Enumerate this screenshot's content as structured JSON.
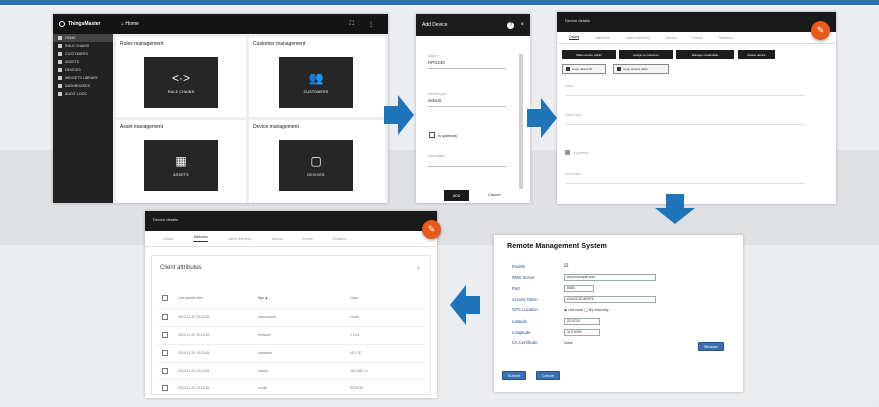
{
  "colors": {
    "accent": "#1f74ba",
    "fab": "#e85a1b",
    "dark": "#1a1a1a"
  },
  "panel1": {
    "logo": "ThingsMaster",
    "home": "Home",
    "sidebar": [
      "Home",
      "Rule chains",
      "Customers",
      "Assets",
      "Devices",
      "Widgets library",
      "Dashboards",
      "Audit logs"
    ],
    "cards": [
      {
        "title": "Rules management",
        "tile": "RULE CHAINS",
        "icon": "<·>"
      },
      {
        "title": "Customer management",
        "tile": "CUSTOMERS",
        "icon": "👥"
      },
      {
        "title": "Asset management",
        "tile": "ASSETS",
        "icon": "▦"
      },
      {
        "title": "Device management",
        "tile": "DEVICES",
        "icon": "▢"
      }
    ]
  },
  "panel2": {
    "title": "Add Device",
    "help": "?",
    "close": "×",
    "name_label": "Name *",
    "name_value": "RPG230",
    "type_label": "Device type *",
    "type_value": "default",
    "gateway": "Is gateway",
    "desc_label": "Description",
    "add": "ADD",
    "cancel": "Cancel"
  },
  "panel3": {
    "title": "Device details",
    "tabs": [
      "Details",
      "Attributes",
      "Latest telemetry",
      "Alarms",
      "Events",
      "Relations"
    ],
    "buttons": [
      "Make device public",
      "Assign to customer",
      "Manage credentials",
      "Delete device"
    ],
    "copy_buttons": [
      "Copy device ID",
      "Copy access token"
    ],
    "fields": [
      "Name",
      "Device type",
      "Is gateway",
      "Description"
    ]
  },
  "panel4": {
    "title": "Remote Management System",
    "rows": [
      {
        "k": "Enable",
        "v": "☑"
      },
      {
        "k": "RMS Server",
        "v": "rms.example.com"
      },
      {
        "k": "Port",
        "v": "8883"
      },
      {
        "k": "Access Token",
        "v": "A1B2C3D4E5F6"
      },
      {
        "k": "GPS Location",
        "v": "◉ Use local   ◯ By manually"
      },
      {
        "k": "Latitude",
        "v": "22.5735"
      },
      {
        "k": "Longitude",
        "v": "113.9282"
      },
      {
        "k": "CA Certificate",
        "v": "None"
      }
    ],
    "browse": "Browse",
    "submit": "Submit",
    "cancel": "Cancel"
  },
  "panel5": {
    "title": "Device details",
    "tabs": [
      "Details",
      "Attributes",
      "Latest telemetry",
      "Alarms",
      "Events",
      "Relations"
    ],
    "section": "Client attributes",
    "head": [
      "Last update time",
      "Key ▲",
      "Value"
    ],
    "rows": [
      [
        "2019-11-20 10:23:45",
        "devicename",
        "router"
      ],
      [
        "2019-11-20 10:23:45",
        "firmware",
        "1.0.15"
      ],
      [
        "2019-11-20 10:23:45",
        "hardware",
        "4G LTE"
      ],
      [
        "2019-11-20 10:23:45",
        "localip",
        "192.168.1.1"
      ],
      [
        "2019-11-20 10:23:45",
        "model",
        "RPG230"
      ]
    ]
  }
}
